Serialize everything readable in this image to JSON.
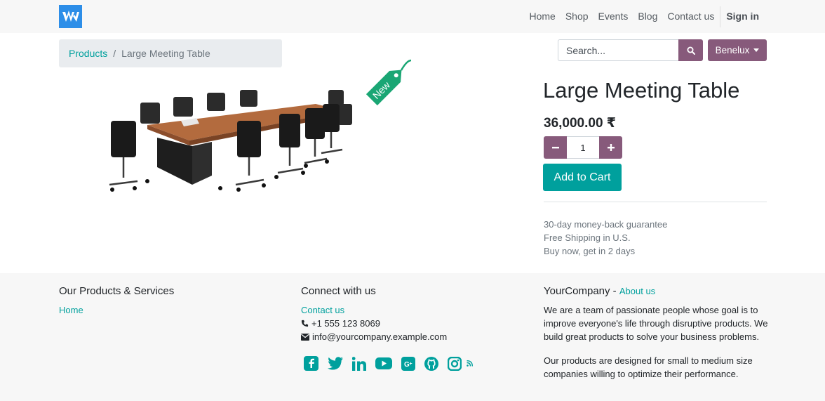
{
  "header": {
    "logo_icon": "odoo-w-logo-icon",
    "nav": [
      "Home",
      "Shop",
      "Events",
      "Blog",
      "Contact us"
    ],
    "signin": "Sign in"
  },
  "breadcrumb": {
    "parent": "Products",
    "separator": "/",
    "current": "Large Meeting Table"
  },
  "search": {
    "placeholder": "Search...",
    "icon": "search-icon"
  },
  "pricelist": {
    "label": "Benelux"
  },
  "product": {
    "name": "Large Meeting Table",
    "price": "36,000.00 ₹",
    "quantity": "1",
    "add_to_cart": "Add to Cart",
    "ribbon": "New",
    "terms": [
      "30-day money-back guarantee",
      "Free Shipping in U.S.",
      "Buy now, get in 2 days"
    ]
  },
  "footer": {
    "products_title": "Our Products & Services",
    "products_links": [
      "Home"
    ],
    "connect_title": "Connect with us",
    "contact_link": "Contact us",
    "phone": "+1 555 123 8069",
    "email": "info@yourcompany.example.com",
    "social_icons": [
      "facebook-icon",
      "twitter-icon",
      "linkedin-icon",
      "youtube-icon",
      "google-plus-icon",
      "github-icon",
      "instagram-icon",
      "rss-icon"
    ],
    "company_title": "YourCompany",
    "company_dash": " - ",
    "about_link": "About us",
    "about_p1": "We are a team of passionate people whose goal is to improve everyone's life through disruptive products. We build great products to solve your business problems.",
    "about_p2": "Our products are designed for small to medium size companies willing to optimize their performance."
  },
  "colors": {
    "primary": "#875a7b",
    "accent": "#00a09d",
    "ribbon": "#1aa674",
    "logo": "#2d8ee8"
  }
}
